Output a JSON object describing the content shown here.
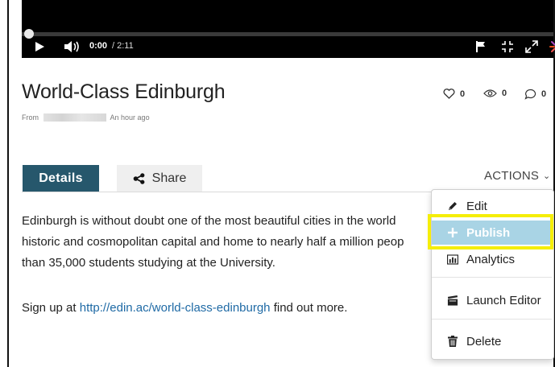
{
  "player": {
    "time_current": "0:00",
    "time_total": "/ 2:11",
    "progress_fraction": 0.0
  },
  "entry": {
    "title": "World-Class Edinburgh",
    "from_label": "From",
    "uploaded": "An hour ago"
  },
  "stats": {
    "likes": "0",
    "views": "0",
    "comments": "0"
  },
  "tabs": {
    "details": "Details",
    "share": "Share"
  },
  "actions": {
    "label": "ACTIONS",
    "caret": "⌄",
    "menu": {
      "edit": "Edit",
      "publish": "Publish",
      "analytics": "Analytics",
      "launch_editor": "Launch Editor",
      "delete": "Delete"
    }
  },
  "description": {
    "line1": "Edinburgh is without doubt one of the most beautiful cities in the world",
    "line2": "historic and cosmopolitan capital and home to nearly half a million peop",
    "line3": "than 35,000 students studying at the University.",
    "signup_prefix": "Sign up at",
    "signup_link": "http://edin.ac/world-class-edinburgh",
    "signup_suffix": "find out more."
  },
  "colors": {
    "details_tab": "#26576c",
    "publish_highlight": "#a9d4e5",
    "annotation_box": "#f5ee08",
    "link": "#1f6aa5"
  },
  "icons": [
    "play-icon",
    "volume-icon",
    "flag-icon",
    "fit-screen-icon",
    "fullscreen-icon",
    "kaltura-logo-icon",
    "heart-icon",
    "eye-icon",
    "comment-icon",
    "share-icon",
    "pencil-icon",
    "plus-icon",
    "bar-chart-icon",
    "clapperboard-icon",
    "trash-icon"
  ]
}
